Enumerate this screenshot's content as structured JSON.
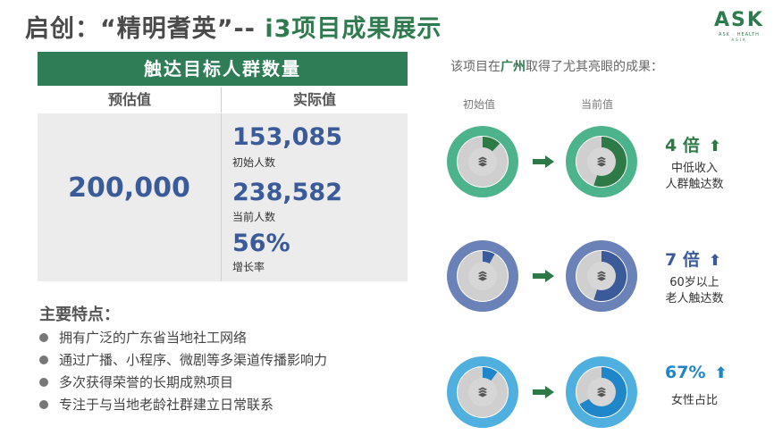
{
  "header": {
    "title_prefix": "启创：“精明耆英”-- ",
    "title_accent": "i3项目成果展示"
  },
  "logo": {
    "mark": "ASK",
    "sub": "ASK · HEALTH",
    "sub2": "ASIA"
  },
  "reach_panel": {
    "title": "触达目标人群数量",
    "col_estimated": "预估值",
    "col_actual": "实际值",
    "estimated_value": "200,000",
    "initial_count": "153,085",
    "initial_label": "初始人数",
    "current_count": "238,582",
    "current_label": "当前人数",
    "growth_rate": "56%",
    "growth_label": "增长率"
  },
  "features": {
    "title": "主要特点：",
    "items": [
      "拥有广泛的广东省当地社工网络",
      "通过广播、小程序、微剧等多渠道传播影响力",
      "多次获得荣誉的长期成熟项目",
      "专注于与当地老龄社群建立日常联系"
    ]
  },
  "results": {
    "caption_before": "该项目在",
    "caption_city": "广州",
    "caption_after": "取得了尤其亮眼的成果：",
    "initial_header": "初始值",
    "current_header": "当前值",
    "rows": [
      {
        "multiplier": "4 倍",
        "label_line1": "中低收入",
        "label_line2": "人群触达数",
        "color": "#2e7a46",
        "ring": "#4db38c",
        "initial_share": 0.12,
        "current_share": 0.55,
        "icon": "stack-icon"
      },
      {
        "multiplier": "7 倍",
        "label_line1": "60岁以上",
        "label_line2": "老人触达数",
        "color": "#3a5a9a",
        "ring": "#6a82b8",
        "initial_share": 0.08,
        "current_share": 0.55,
        "icon": "stack-icon"
      },
      {
        "multiplier": "67%",
        "label_line1": "女性占比",
        "label_line2": "",
        "color": "#1f86c9",
        "ring": "#4fb0e0",
        "initial_share": 0.1,
        "current_share": 0.67,
        "icon": "stack-icon"
      }
    ],
    "arrow_color": "#2e7a46"
  }
}
